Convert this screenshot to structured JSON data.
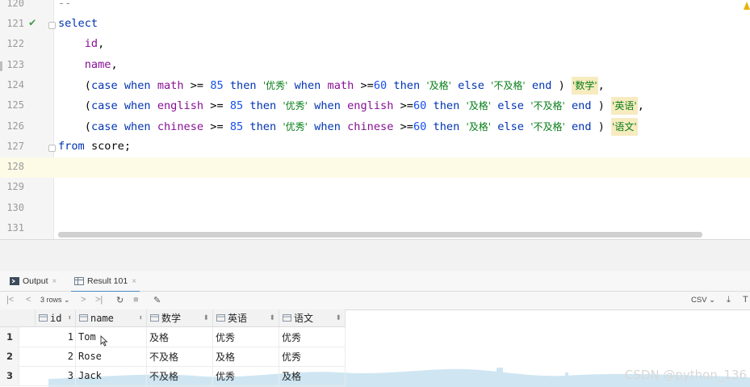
{
  "editor": {
    "lines": [
      {
        "n": "120",
        "text": "--"
      },
      {
        "n": "121"
      },
      {
        "n": "122"
      },
      {
        "n": "123"
      },
      {
        "n": "124"
      },
      {
        "n": "125"
      },
      {
        "n": "126"
      },
      {
        "n": "127"
      },
      {
        "n": "128"
      },
      {
        "n": "129"
      },
      {
        "n": "130"
      },
      {
        "n": "131"
      }
    ],
    "kw": {
      "select": "select",
      "case": "case",
      "when": "when",
      "then": "then",
      "else": "else",
      "end": "end",
      "from": "from"
    },
    "fields": {
      "id": "id",
      "name": "name",
      "math": "math",
      "english": "english",
      "chinese": "chinese"
    },
    "nums": {
      "n85": "85",
      "n60": "60"
    },
    "strs": {
      "excellent": "'优秀'",
      "pass": "'及格'",
      "fail": "'不及格'"
    },
    "aliases": {
      "math": "'数学'",
      "english": "'英语'",
      "chinese": "'语文'"
    },
    "punct": {
      "comma": ",",
      "ge": ">=",
      "lparen": "(",
      "rparen": ")",
      "semi": ";"
    },
    "table": "score",
    "current_line": "128"
  },
  "tabs": [
    {
      "label": "Output"
    },
    {
      "label": "Result 101"
    }
  ],
  "toolbar": {
    "rows_label": "3 rows",
    "export_format": "CSV"
  },
  "grid": {
    "columns": [
      "id",
      "name",
      "数学",
      "英语",
      "语文"
    ],
    "rows": [
      {
        "rn": "1",
        "id": "1",
        "name": "Tom",
        "math": "及格",
        "english": "优秀",
        "chinese": "优秀"
      },
      {
        "rn": "2",
        "id": "2",
        "name": "Rose",
        "math": "不及格",
        "english": "及格",
        "chinese": "优秀"
      },
      {
        "rn": "3",
        "id": "3",
        "name": "Jack",
        "math": "不及格",
        "english": "优秀",
        "chinese": "及格"
      }
    ]
  },
  "watermark": "CSDN @python_136",
  "colors": {
    "keyword": "#0033b3",
    "field": "#871094",
    "number": "#1750eb",
    "string": "#067d17",
    "alias_bg": "#f7ebc0",
    "tab_accent": "#4a88c7"
  },
  "icons": [
    "checkmark-icon",
    "fold-icon",
    "warning-icon",
    "output-icon",
    "table-icon",
    "close-icon",
    "first-page-icon",
    "prev-page-icon",
    "next-page-icon",
    "last-page-icon",
    "refresh-icon",
    "stop-icon",
    "pin-icon",
    "download-icon",
    "upload-icon",
    "sort-icon",
    "column-icon",
    "mouse-cursor-icon"
  ]
}
